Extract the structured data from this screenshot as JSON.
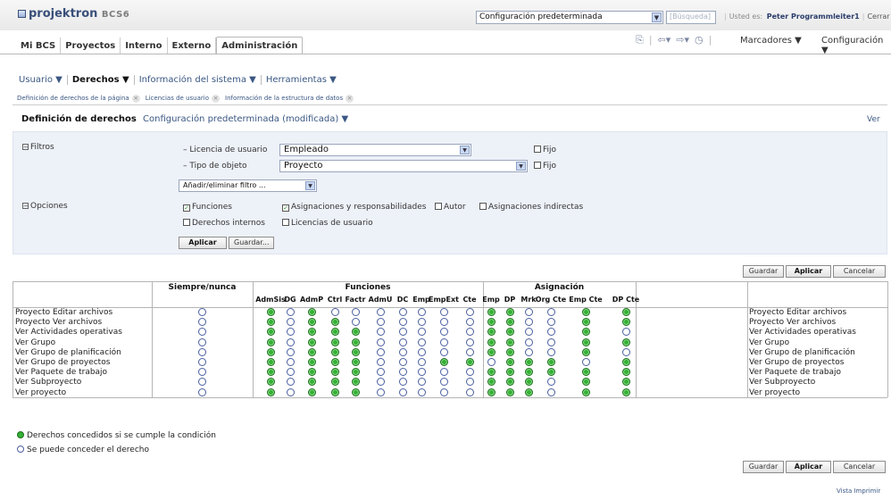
{
  "header": {
    "logo_text": "projektron",
    "logo_suffix": "BCS6",
    "config_select": "Configuración predeterminada",
    "search_placeholder": "Búsqueda",
    "user_prefix": "Usted es:",
    "user_name": "Peter Programmleiter1",
    "logout": "Cerrar sesió"
  },
  "main_tabs": [
    "Mi BCS",
    "Proyectos",
    "Interno",
    "Externo",
    "Administración"
  ],
  "toolbar": {
    "bookmarks": "Marcadores ▼",
    "configuration": "Configuración ▼"
  },
  "submenu": [
    "Usuario ▼",
    "Derechos ▼",
    "Información del sistema ▼",
    "Herramientas ▼"
  ],
  "breadcrumbs": [
    "Definición de derechos de la página",
    "Licencias de usuario",
    "Información de la estructura de datos"
  ],
  "page": {
    "title": "Definición de derechos",
    "config": "Configuración predeterminada (modificada) ▼",
    "view_link": "Ver"
  },
  "filters": {
    "section": "Filtros",
    "license_label": "– Licencia de usuario",
    "license_value": "Empleado",
    "object_label": "– Tipo de objeto",
    "object_value": "Proyecto",
    "fixed": "Fijo",
    "add_filter": "Añadir/eliminar filtro ..."
  },
  "options": {
    "section": "Opciones",
    "items": [
      {
        "label": "Funciones",
        "checked": true
      },
      {
        "label": "Asignaciones y responsabilidades",
        "checked": true
      },
      {
        "label": "Autor",
        "checked": false
      },
      {
        "label": "Asignaciones indirectas",
        "checked": false
      },
      {
        "label": "Derechos internos",
        "checked": false
      },
      {
        "label": "Licencias de usuario",
        "checked": false
      }
    ],
    "apply": "Aplicar",
    "save": "Guardar..."
  },
  "actions": {
    "save": "Guardar",
    "apply": "Aplicar",
    "cancel": "Cancelar"
  },
  "matrix": {
    "group_always": "Siempre/nunca",
    "group_functions": "Funciones",
    "group_assignment": "Asignación",
    "function_cols": [
      "AdmSis",
      "DG",
      "AdmP",
      "Ctrl",
      "Factr",
      "AdmU",
      "DC",
      "Emp",
      "EmpExt",
      "Cte"
    ],
    "assign_cols": [
      "Emp",
      "DP",
      "Mrk",
      "Org Cte",
      "Emp Cte",
      "DP Cte"
    ],
    "rows": [
      {
        "label": "Proyecto Editar archivos",
        "cells": "o g o g o o o o o o o g g o o g g"
      },
      {
        "label": "Proyecto Ver archivos",
        "cells": "o g o g g o o o o o o g g o o g g"
      },
      {
        "label": "Ver Actividades operativas",
        "cells": "o g o g g g o o o o o g g o o g o"
      },
      {
        "label": "Ver Grupo",
        "cells": "o g o g g g o o o o o g g o o g g"
      },
      {
        "label": "Ver Grupo de planificación",
        "cells": "o g o g g g o o o o o g g o o g o"
      },
      {
        "label": "Ver Grupo de proyectos",
        "cells": "o g o g g g o o o g g o g g g o g g"
      },
      {
        "label": "Ver Paquete de trabajo",
        "cells": "o g o g g g o o o o o g g g g g g"
      },
      {
        "label": "Ver Subproyecto",
        "cells": "o g o g g g o o o o o g g g o g g"
      },
      {
        "label": "Ver proyecto",
        "cells": "o g o g g g o o o o o g g g o g g"
      }
    ]
  },
  "legend": {
    "granted": "Derechos concedidos si se cumple la condición",
    "can_grant": "Se puede conceder el derecho"
  },
  "footer": {
    "print_view": "Vista Imprimir"
  }
}
